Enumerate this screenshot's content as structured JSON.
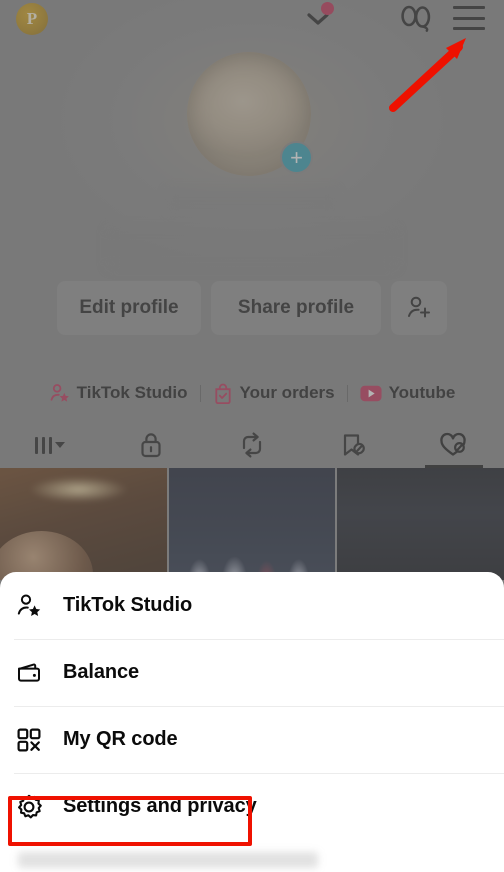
{
  "app": {
    "name": "TikTok",
    "screen": "Profile"
  },
  "top_bar": {
    "badge_letter": "P",
    "badge_name": "pro-badge",
    "chevron_icon": "chevron-down-icon",
    "has_notification_dot": true,
    "notification_dot_color": "#c2264f",
    "footprints_icon": "footprints-icon",
    "menu_icon": "hamburger-menu-icon"
  },
  "profile": {
    "avatar_icon": "profile-avatar",
    "add_photo_badge": "+",
    "add_photo_badge_color": "#2b9fb3",
    "username_redacted": true,
    "stats_redacted": true
  },
  "actions": {
    "edit_profile_label": "Edit profile",
    "share_profile_label": "Share profile",
    "add_friends_icon": "add-person-icon"
  },
  "shortcuts": [
    {
      "label": "TikTok Studio",
      "icon": "person-star-icon",
      "color": "#c42a55"
    },
    {
      "label": "Your orders",
      "icon": "shopping-bag-check-icon",
      "color": "#c42a55"
    },
    {
      "label": "Youtube",
      "icon": "youtube-play-icon",
      "color": "#c42a55"
    }
  ],
  "tabs": [
    {
      "name": "posts-grid",
      "icon": "grid-bars-icon",
      "active": false,
      "has_caret": true
    },
    {
      "name": "private",
      "icon": "lock-icon",
      "active": false
    },
    {
      "name": "reposts",
      "icon": "repost-icon",
      "active": false
    },
    {
      "name": "saved",
      "icon": "bookmark-hidden-icon",
      "active": false
    },
    {
      "name": "liked",
      "icon": "heart-hidden-icon",
      "active": true
    }
  ],
  "videos": [
    {
      "name": "video-thumbnail-1"
    },
    {
      "name": "video-thumbnail-2"
    },
    {
      "name": "video-thumbnail-3"
    }
  ],
  "bottom_sheet": {
    "items": [
      {
        "label": "TikTok Studio",
        "icon": "person-star-icon"
      },
      {
        "label": "Balance",
        "icon": "wallet-icon"
      },
      {
        "label": "My QR code",
        "icon": "qr-code-icon"
      },
      {
        "label": "Settings and privacy",
        "icon": "gear-icon",
        "highlighted": true
      }
    ]
  },
  "annotations": {
    "arrow": {
      "name": "red-arrow-pointing-to-menu",
      "color": "#ee1100",
      "points_to": "hamburger-menu-icon"
    },
    "highlight_box": {
      "name": "red-highlight-box",
      "color": "#ef1100",
      "targets": "Settings and privacy"
    }
  },
  "colors": {
    "dim_overlay": "#808080",
    "sheet_background": "#ffffff",
    "annotation_red": "#ef1100",
    "accent_teal": "#2b9fb3",
    "accent_pink": "#c42a55"
  }
}
